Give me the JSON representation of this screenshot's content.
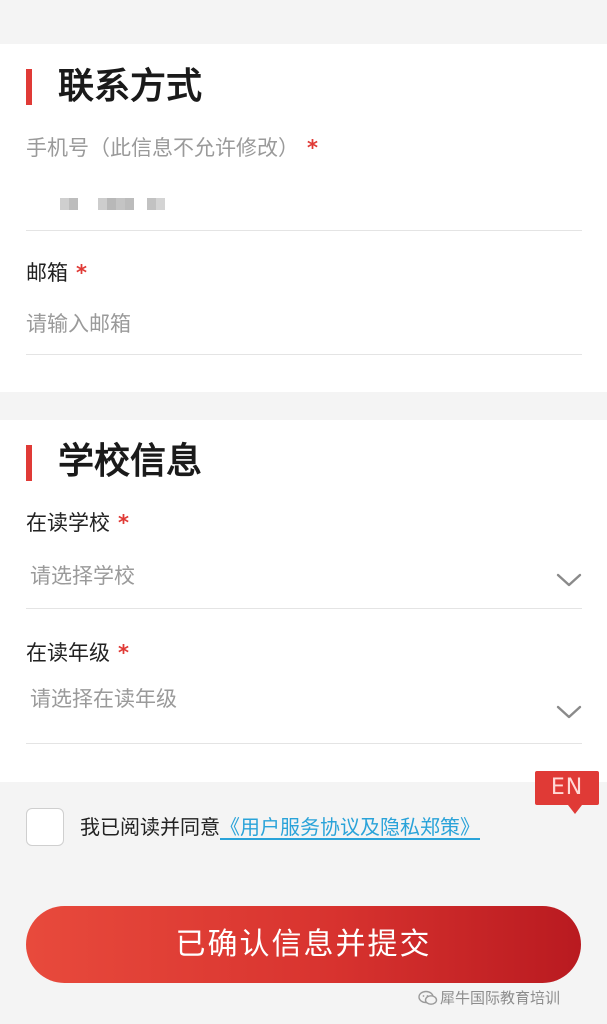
{
  "contact": {
    "title": "联系方式",
    "phone": {
      "label": "手机号（此信息不允许修改）",
      "required_mark": "*"
    },
    "email": {
      "label": "邮箱",
      "required_mark": "*",
      "placeholder": "请输入邮箱"
    }
  },
  "school": {
    "title": "学校信息",
    "current_school": {
      "label": "在读学校",
      "required_mark": "*",
      "placeholder": "请选择学校"
    },
    "current_grade": {
      "label": "在读年级",
      "required_mark": "*",
      "placeholder": "请选择在读年级"
    }
  },
  "agreement": {
    "prefix": "我已阅读并同意",
    "link": "《用户服务协议及隐私郑策》",
    "checked": false
  },
  "language_badge": "EN",
  "submit_label": "已确认信息并提交",
  "watermark": "犀牛国际教育培训",
  "colors": {
    "accent": "#e03a36",
    "link": "#2aa3d9",
    "button_start": "#e84a3c",
    "button_end": "#b91a20"
  },
  "icons": {
    "dropdown": "chevron-down-icon",
    "watermark": "wechat-icon"
  }
}
